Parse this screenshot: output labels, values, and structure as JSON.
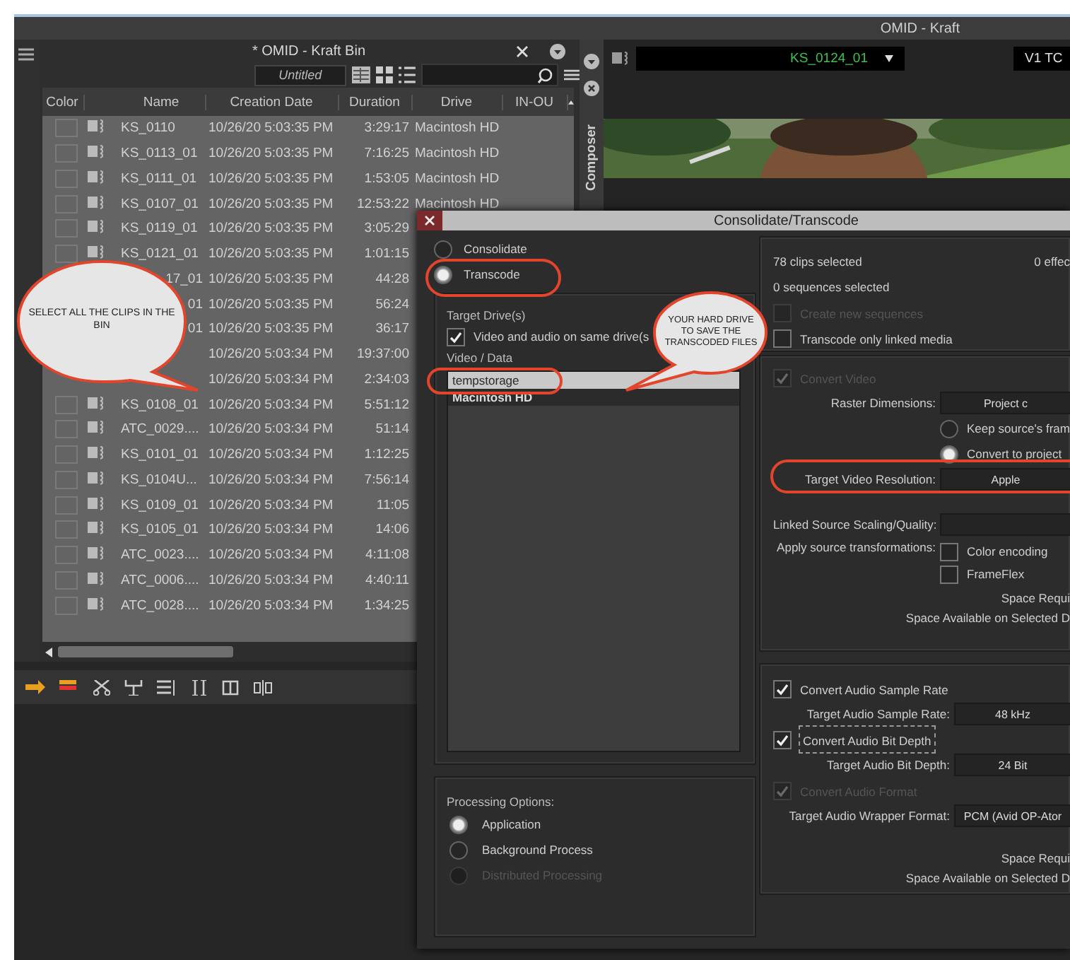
{
  "app_title": "OMID - Kraft",
  "bin": {
    "title": "* OMID - Kraft Bin",
    "view": "Untitled",
    "columns": [
      "Color",
      "Name",
      "Creation Date",
      "Duration",
      "Drive",
      "IN-OU"
    ],
    "rows": [
      {
        "kind": "full",
        "name": "KS_0110",
        "date": "10/26/20 5:03:35 PM",
        "duration": "3:29:17",
        "drive": "Macintosh HD"
      },
      {
        "kind": "full",
        "name": "KS_0113_01",
        "date": "10/26/20 5:03:35 PM",
        "duration": "7:16:25",
        "drive": "Macintosh HD"
      },
      {
        "kind": "full",
        "name": "KS_0111_01",
        "date": "10/26/20 5:03:35 PM",
        "duration": "1:53:05",
        "drive": "Macintosh HD"
      },
      {
        "kind": "full",
        "name": "KS_0107_01",
        "date": "10/26/20 5:03:35 PM",
        "duration": "12:53:22",
        "drive": "Macintosh HD"
      },
      {
        "kind": "full",
        "name": "KS_0119_01",
        "date": "10/26/20 5:03:35 PM",
        "duration": "3:05:29"
      },
      {
        "kind": "full",
        "name": "KS_0121_01",
        "date": "10/26/20 5:03:35 PM",
        "duration": "1:01:15"
      },
      {
        "kind": "partial",
        "name": "17_01",
        "date": "10/26/20 5:03:35 PM",
        "duration": "44:28"
      },
      {
        "kind": "partial",
        "name": "01",
        "date": "10/26/20 5:03:35 PM",
        "duration": "56:24"
      },
      {
        "kind": "partial",
        "name": "01",
        "date": "10/26/20 5:03:35 PM",
        "duration": "36:17"
      },
      {
        "kind": "partial",
        "date": "10/26/20 5:03:34 PM",
        "duration": "19:37:00"
      },
      {
        "kind": "partial",
        "date": "10/26/20 5:03:34 PM",
        "duration": "2:34:03"
      },
      {
        "kind": "full",
        "name": "KS_0108_01",
        "date": "10/26/20 5:03:34 PM",
        "duration": "5:51:12"
      },
      {
        "kind": "full",
        "name": "ATC_0029....",
        "date": "10/26/20 5:03:34 PM",
        "duration": "51:14"
      },
      {
        "kind": "full",
        "name": "KS_0101_01",
        "date": "10/26/20 5:03:34 PM",
        "duration": "1:12:25"
      },
      {
        "kind": "full",
        "name": "KS_0104U...",
        "date": "10/26/20 5:03:34 PM",
        "duration": "7:56:14"
      },
      {
        "kind": "full",
        "name": "KS_0109_01",
        "date": "10/26/20 5:03:34 PM",
        "duration": "11:05"
      },
      {
        "kind": "full",
        "name": "KS_0105_01",
        "date": "10/26/20 5:03:34 PM",
        "duration": "14:06"
      },
      {
        "kind": "full",
        "name": "ATC_0023....",
        "date": "10/26/20 5:03:34 PM",
        "duration": "4:11:08"
      },
      {
        "kind": "full",
        "name": "ATC_0006....",
        "date": "10/26/20 5:03:34 PM",
        "duration": "4:40:11"
      },
      {
        "kind": "full",
        "name": "ATC_0028....",
        "date": "10/26/20 5:03:34 PM",
        "duration": "1:34:25"
      }
    ]
  },
  "composer": {
    "label": "Composer",
    "clip": "KS_0124_01",
    "track": "V1  TC"
  },
  "dialog": {
    "title": "Consolidate/Transcode",
    "modes": [
      {
        "label": "Consolidate",
        "selected": false
      },
      {
        "label": "Transcode",
        "selected": true
      }
    ],
    "drives": {
      "heading": "Target Drive(s)",
      "same_drive": {
        "label": "Video and audio on same drive(s",
        "checked": true
      },
      "list_label": "Video / Data",
      "items": [
        {
          "label": "tempstorage",
          "selected": true,
          "bold": false
        },
        {
          "label": "Macintosh HD",
          "selected": false,
          "bold": true
        }
      ]
    },
    "processing": {
      "heading": "Processing Options:",
      "options": [
        {
          "label": "Application",
          "selected": true,
          "disabled": false
        },
        {
          "label": "Background Process",
          "selected": false,
          "disabled": false
        },
        {
          "label": "Distributed Processing",
          "selected": false,
          "disabled": true
        }
      ]
    },
    "panels": [
      {
        "rows": [
          {
            "kind": "info",
            "text": "78 clips selected",
            "aside": "0 effec"
          },
          {
            "kind": "info",
            "text": "0 sequences selected"
          },
          {
            "kind": "check",
            "label": "Create new sequences",
            "checked": false,
            "disabled": true,
            "focused": false
          },
          {
            "kind": "check",
            "label": "Transcode only linked media",
            "checked": false,
            "disabled": false,
            "focused": false
          }
        ]
      },
      {
        "rows": [
          {
            "kind": "check",
            "label": "Convert Video",
            "checked": true,
            "disabled": true,
            "focused": false
          },
          {
            "kind": "field",
            "label": "Raster Dimensions:",
            "value": "Project c"
          },
          {
            "kind": "radio",
            "label": "Keep source's fram",
            "selected": false
          },
          {
            "kind": "radio",
            "label": "Convert to project",
            "selected": true
          },
          {
            "kind": "field",
            "label": "Target Video Resolution:",
            "value": "Apple"
          },
          {
            "kind": "gap"
          },
          {
            "kind": "field",
            "label": "Linked Source Scaling/Quality:"
          },
          {
            "kind": "checks",
            "label": "Apply source transformations:",
            "options": [
              {
                "label": "Color encoding",
                "checked": false
              },
              {
                "label": "FrameFlex",
                "checked": false
              }
            ]
          },
          {
            "kind": "note",
            "text": "Space Requi"
          },
          {
            "kind": "note",
            "text": "Space Available on Selected D"
          }
        ]
      },
      {
        "rows": [
          {
            "kind": "check",
            "label": "Convert Audio Sample Rate",
            "checked": true,
            "disabled": false,
            "focused": false
          },
          {
            "kind": "field",
            "label": "Target Audio Sample Rate:",
            "value": "48 kHz"
          },
          {
            "kind": "check",
            "label": "Convert Audio Bit Depth",
            "checked": true,
            "disabled": false,
            "focused": true
          },
          {
            "kind": "field",
            "label": "Target Audio Bit Depth:",
            "value": "24 Bit"
          },
          {
            "kind": "check",
            "label": "Convert Audio Format",
            "checked": true,
            "disabled": true,
            "focused": false
          },
          {
            "kind": "field",
            "label": "Target Audio Wrapper Format:",
            "value": "PCM  (Avid OP-Ator"
          },
          {
            "kind": "gap"
          },
          {
            "kind": "note",
            "text": "Space Requi"
          },
          {
            "kind": "note",
            "text": "Space Available on Selected D"
          }
        ]
      }
    ]
  },
  "callouts": [
    {
      "text": "SELECT ALL THE CLIPS IN THE BIN"
    },
    {
      "text": "YOUR HARD DRIVE TO SAVE THE TRANSCODED FILES"
    }
  ]
}
